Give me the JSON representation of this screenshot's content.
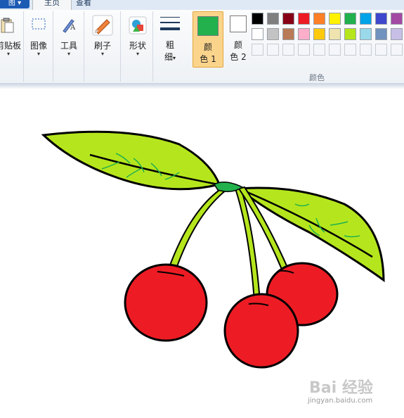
{
  "tabs": {
    "file": "图 ▾",
    "home": "主页",
    "view": "查看"
  },
  "toolbar": {
    "clipboard_label": "剪贴板",
    "image_label": "图像",
    "tools_label": "工具",
    "brushes_label": "刷子",
    "shapes_label": "形状",
    "size_label_line1": "粗",
    "size_label_line2": "细",
    "color1_line1": "颜",
    "color1_line2": "色 1",
    "color2_line1": "颜",
    "color2_line2": "色 2",
    "arrow": "▾",
    "colors_group_caption": "颜色"
  },
  "colors": {
    "color1": "#22b14c",
    "color2": "#ffffff",
    "palette_row1": [
      "#000000",
      "#7f7f7f",
      "#880015",
      "#ed1c24",
      "#ff7f27",
      "#fff200",
      "#22b14c",
      "#00a2e8",
      "#3f48cc",
      "#a349a4"
    ],
    "palette_row2": [
      "#ffffff",
      "#c3c3c3",
      "#b97a57",
      "#ffaec9",
      "#ffc90e",
      "#efe4b0",
      "#b5e61d",
      "#99d9ea",
      "#7092be",
      "#c8bfe7"
    ]
  },
  "drawing": {
    "subject": "cherries",
    "cherry_color": "#ed1c24",
    "leaf_color": "#b5e61d",
    "vein_color": "#22b14c",
    "stem_color": "#b5e61d",
    "knot_color": "#22b14c"
  },
  "watermark": {
    "brand": "Bai 经验",
    "url": "jingyan.baidu.com"
  }
}
